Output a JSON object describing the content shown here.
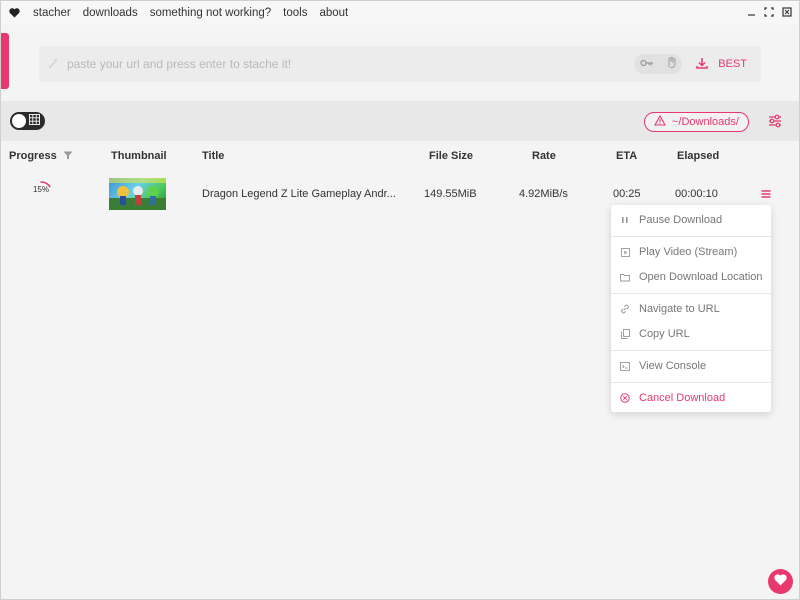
{
  "menubar": {
    "items": [
      "stacher",
      "downloads",
      "something not working?",
      "tools",
      "about"
    ]
  },
  "url": {
    "placeholder": "paste your url and press enter to stache it!",
    "quality_label": "BEST"
  },
  "toolbar": {
    "download_path": "~/Downloads/"
  },
  "table": {
    "columns": [
      "Progress",
      "Thumbnail",
      "Title",
      "File Size",
      "Rate",
      "ETA",
      "Elapsed"
    ],
    "rows": [
      {
        "progress": 0.15,
        "progress_label": "15%",
        "title": "Dragon Legend Z Lite Gameplay Andr...",
        "file_size": "149.55MiB",
        "rate": "4.92MiB/s",
        "eta": "00:25",
        "elapsed": "00:00:10"
      }
    ]
  },
  "context_menu": {
    "items": [
      {
        "label": "Pause Download",
        "icon": "pause-icon"
      },
      {
        "label": "Play Video (Stream)",
        "icon": "play-icon"
      },
      {
        "label": "Open Download Location",
        "icon": "folder-icon"
      },
      {
        "label": "Navigate to URL",
        "icon": "link-icon"
      },
      {
        "label": "Copy URL",
        "icon": "copy-icon"
      },
      {
        "label": "View Console",
        "icon": "console-icon"
      },
      {
        "label": "Cancel Download",
        "icon": "cancel-icon"
      }
    ]
  },
  "colors": {
    "accent": "#e8386d",
    "background": "#f4f4f4"
  }
}
